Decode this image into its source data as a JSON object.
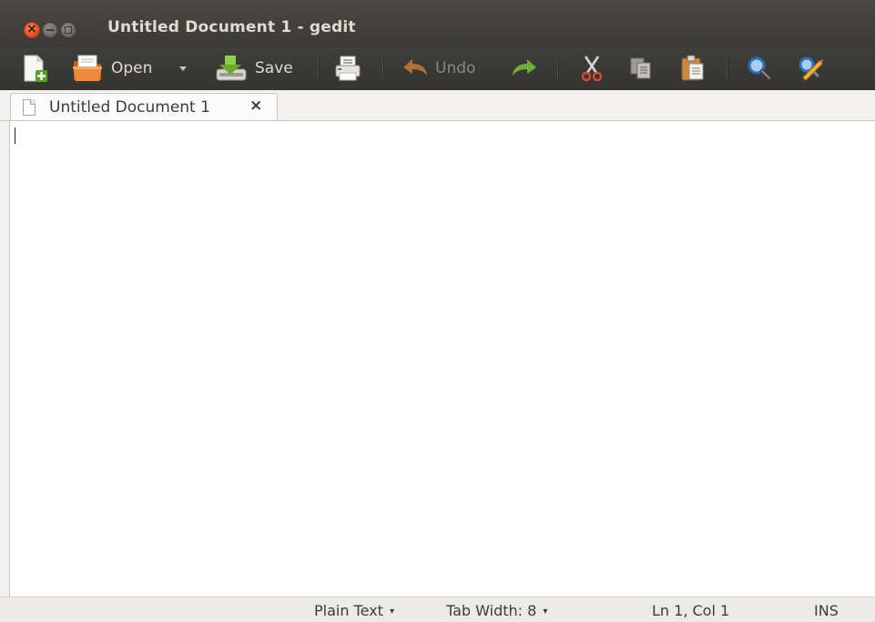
{
  "window": {
    "title": "Untitled Document 1 - gedit",
    "buttons": [
      "close",
      "minimize",
      "maximize"
    ]
  },
  "toolbar": {
    "items": [
      {
        "name": "new",
        "icon": "new-document-icon"
      },
      {
        "name": "open",
        "label": "Open",
        "icon": "open-folder-icon"
      },
      {
        "name": "open-recent",
        "icon": "dropdown-arrow-icon"
      },
      {
        "name": "save",
        "label": "Save",
        "icon": "save-icon"
      },
      {
        "name": "print",
        "icon": "print-icon"
      },
      {
        "name": "undo",
        "label": "Undo",
        "icon": "undo-icon",
        "disabled": true
      },
      {
        "name": "redo",
        "icon": "redo-icon"
      },
      {
        "name": "cut",
        "icon": "cut-icon"
      },
      {
        "name": "copy",
        "icon": "copy-icon"
      },
      {
        "name": "paste",
        "icon": "paste-icon"
      },
      {
        "name": "find",
        "icon": "search-icon"
      },
      {
        "name": "replace",
        "icon": "find-replace-icon"
      }
    ]
  },
  "tabs": [
    {
      "label": "Untitled Document 1",
      "close_label": "×",
      "active": true
    }
  ],
  "editor": {
    "content": ""
  },
  "statusbar": {
    "language": "Plain Text",
    "tab_width": "Tab Width: 8",
    "position": "Ln 1, Col 1",
    "mode": "INS",
    "dropdown_arrow": "▾"
  },
  "colors": {
    "titlebar": "#3b3a36",
    "toolbar": "#3a3935",
    "close_button": "#e0471b",
    "editor_bg": "#ffffff",
    "statusbar_bg": "#eceae7"
  }
}
